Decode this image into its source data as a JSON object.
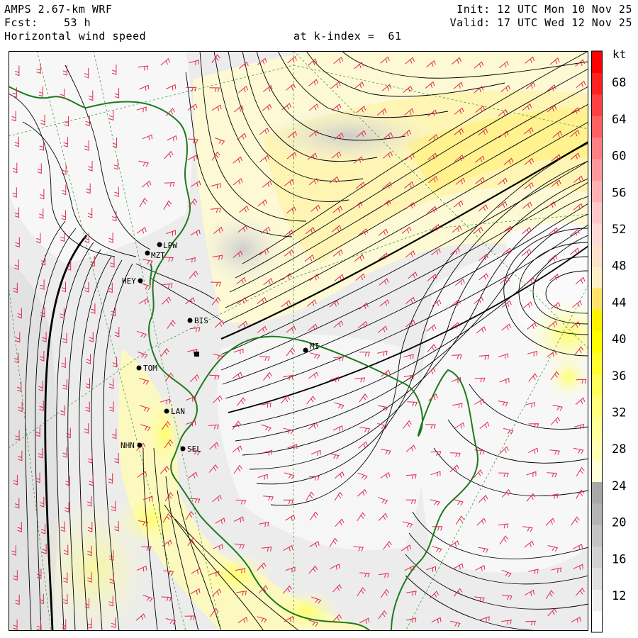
{
  "header": {
    "model": "AMPS 2.67-km WRF",
    "forecast_label": "Fcst:",
    "forecast_value": "53 h",
    "field": "Horizontal wind speed",
    "level": "at k-index =  61",
    "init": "Init: 12 UTC Mon 10 Nov 25",
    "valid": "Valid: 17 UTC Wed 12 Nov 25"
  },
  "colorbar": {
    "unit": "kt",
    "ticks": [
      "12",
      "16",
      "20",
      "24",
      "28",
      "32",
      "36",
      "40",
      "44",
      "48",
      "52",
      "56",
      "60",
      "64",
      "68"
    ],
    "colors": [
      "#ffffff",
      "#f0f0f0",
      "#e1e1e1",
      "#d2d2d2",
      "#c3c3c3",
      "#b4b4b4",
      "#a8a8a8",
      "#ffffd8",
      "#ffffb4",
      "#ffff98",
      "#ffff7a",
      "#ffff5c",
      "#ffff2e",
      "#ffff00",
      "#fff200",
      "#ffe36a",
      "#fff0c8",
      "#ffe0c8",
      "#ffd8d8",
      "#ffc8c8",
      "#ffb0b0",
      "#ff9898",
      "#ff8080",
      "#ff6060",
      "#ff4040",
      "#ff2020",
      "#ff0000"
    ]
  },
  "stations": [
    {
      "id": "LPW"
    },
    {
      "id": "MZT"
    },
    {
      "id": "HEY"
    },
    {
      "id": "BIS"
    },
    {
      "id": "TOM"
    },
    {
      "id": "LAN"
    },
    {
      "id": "NHN"
    },
    {
      "id": "SEL"
    },
    {
      "id": "MI"
    }
  ]
}
